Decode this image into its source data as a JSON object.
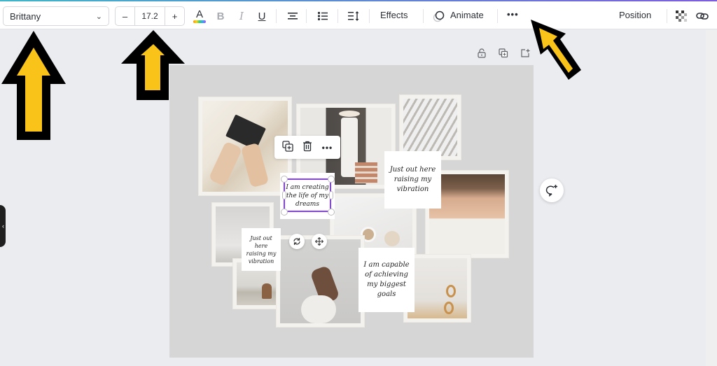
{
  "toolbar": {
    "font_family": "Brittany",
    "font_size": "17.2",
    "decrease_label": "–",
    "increase_label": "+",
    "text_color_letter": "A",
    "bold_label": "B",
    "italic_label": "I",
    "underline_label": "U",
    "effects_label": "Effects",
    "animate_label": "Animate",
    "more_label": "•••",
    "position_label": "Position"
  },
  "canvas": {
    "notes": [
      "I am creating the life of my dreams",
      "Just out here raising my vibration",
      "Just out here raising my vibration",
      "I am capable of achieving my biggest goals"
    ],
    "context_menu": {
      "duplicate_icon": "duplicate-icon",
      "delete_icon": "trash-icon",
      "more_label": "•••"
    }
  },
  "colors": {
    "accent": "#8b3dff",
    "arrow_fill": "#f9c319",
    "arrow_outline": "#000000",
    "page_bg": "#d6d6d6",
    "workspace_bg": "#ebecf0"
  }
}
